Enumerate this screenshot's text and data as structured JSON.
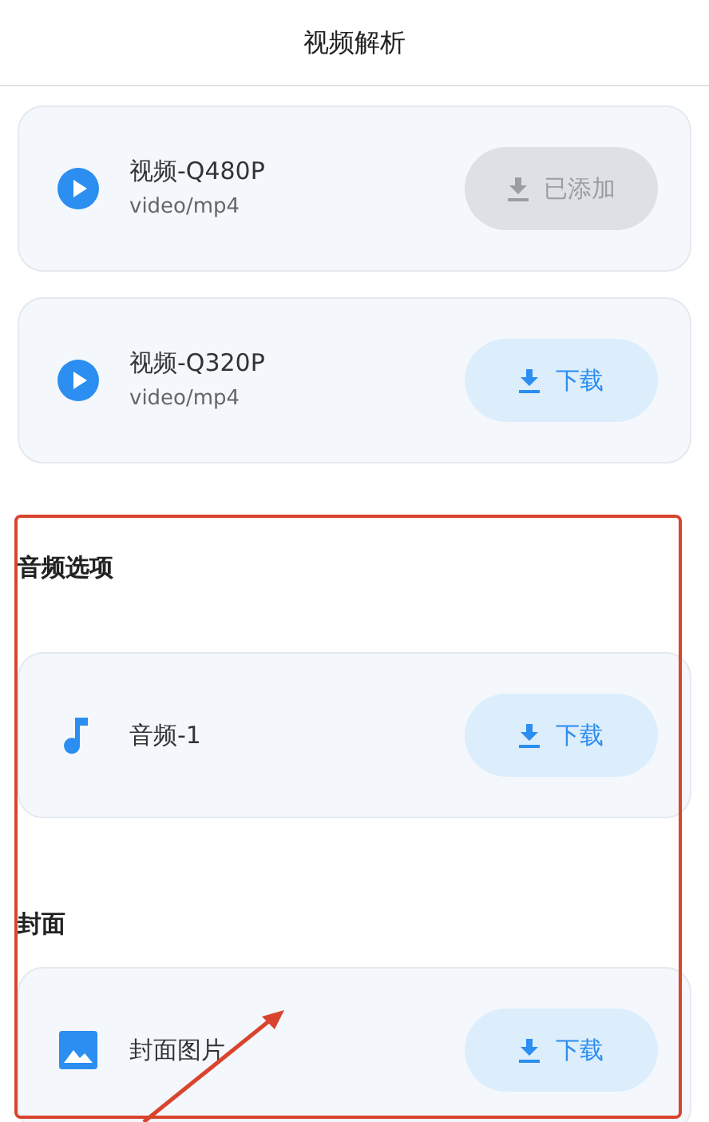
{
  "header": {
    "title": "视频解析"
  },
  "sections": [
    {
      "items": [
        {
          "kind": "video",
          "title": "视频-Q480P",
          "subtitle": "video/mp4",
          "button": {
            "label": "已添加",
            "disabled": true
          }
        },
        {
          "kind": "video",
          "title": "视频-Q320P",
          "subtitle": "video/mp4",
          "button": {
            "label": "下载",
            "disabled": false
          }
        }
      ]
    },
    {
      "heading": "音频选项",
      "items": [
        {
          "kind": "audio",
          "title": "音频-1",
          "button": {
            "label": "下载",
            "disabled": false
          }
        }
      ]
    },
    {
      "heading": "封面",
      "items": [
        {
          "kind": "image",
          "title": "封面图片",
          "button": {
            "label": "下载",
            "disabled": false
          }
        }
      ]
    }
  ]
}
